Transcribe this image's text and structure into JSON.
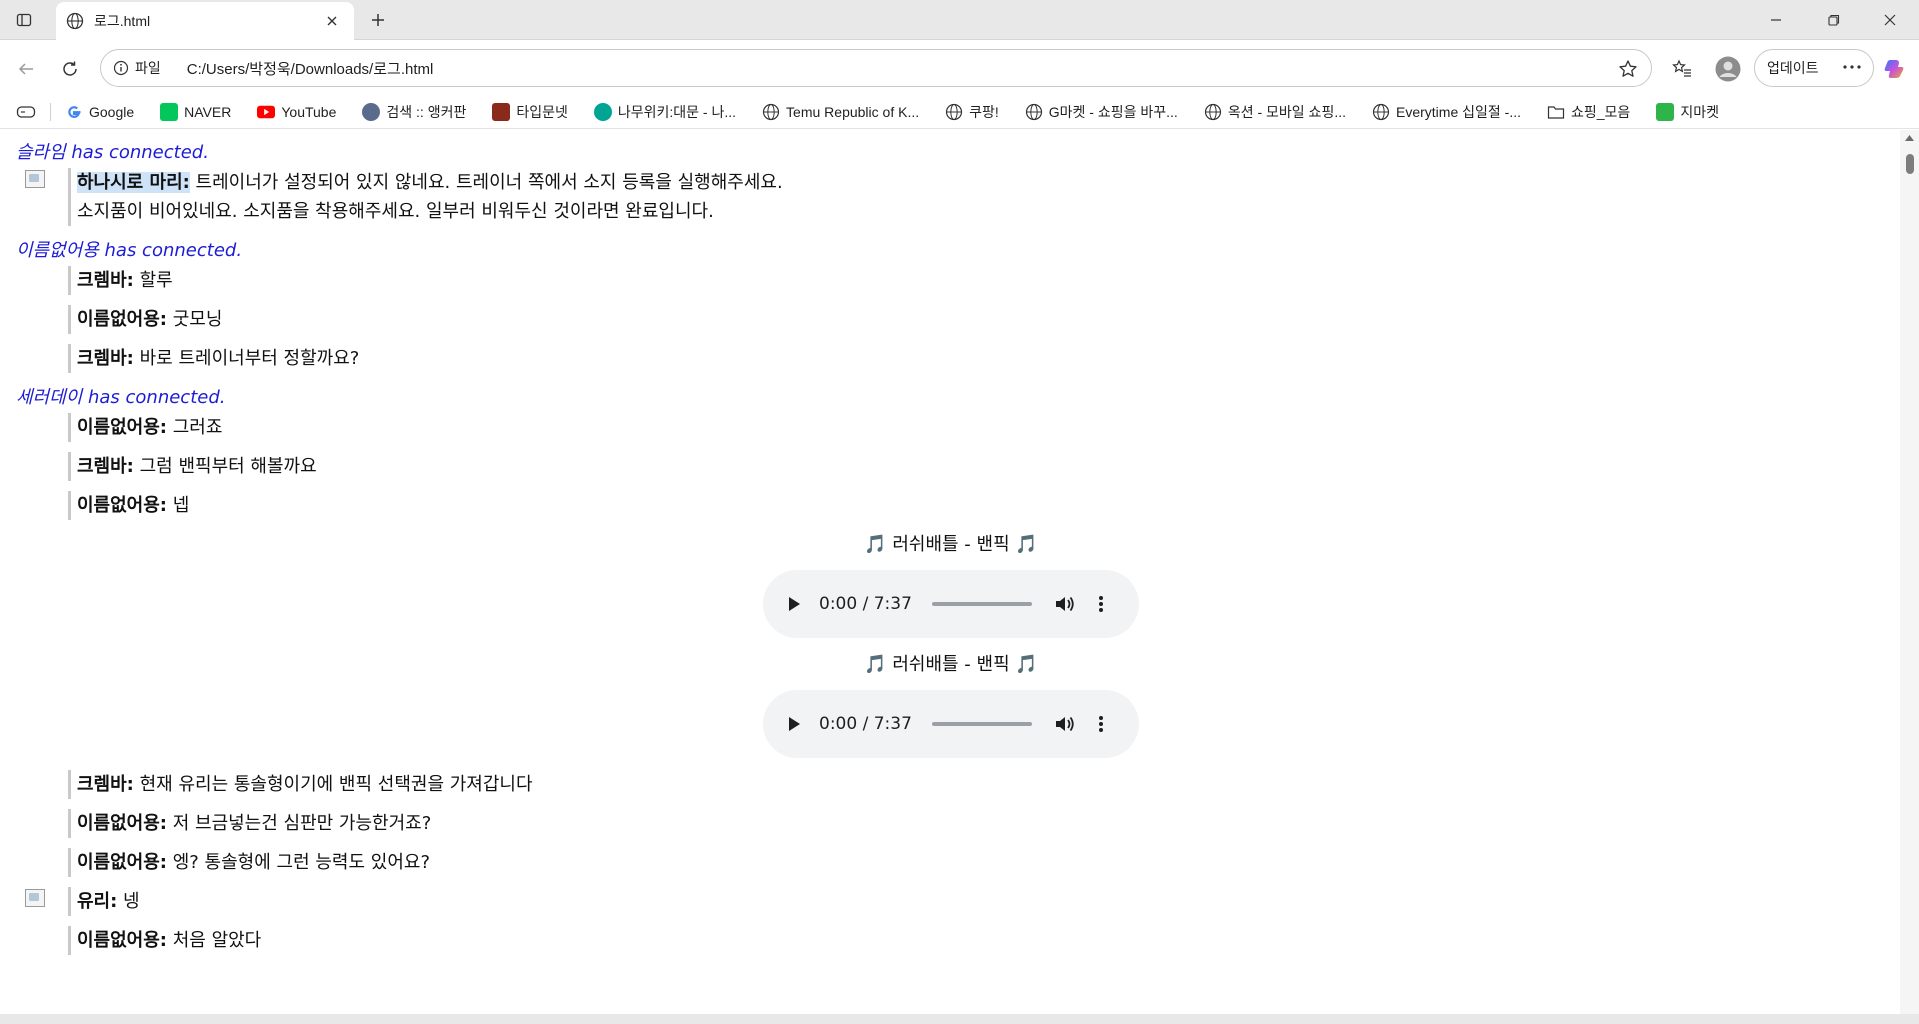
{
  "tab": {
    "title": "로그.html"
  },
  "address": {
    "scheme": "파일",
    "url": "C:/Users/박정욱/Downloads/로그.html"
  },
  "toolbar": {
    "update_label": "업데이트"
  },
  "bookmarks": [
    {
      "label": "Google",
      "icon": "google-icon",
      "color": "#4285f4"
    },
    {
      "label": "NAVER",
      "icon": "naver-icon",
      "color": "#03c75a"
    },
    {
      "label": "YouTube",
      "icon": "youtube-icon",
      "color": "#ff0000"
    },
    {
      "label": "검색 :: 앵커판",
      "icon": "anchor-site-icon",
      "color": "#5b6b8c"
    },
    {
      "label": "타입문넷",
      "icon": "typemoon-icon",
      "color": "#8a2a1a"
    },
    {
      "label": "나무위키:대문 - 나...",
      "icon": "namuwiki-icon",
      "color": "#00a495"
    },
    {
      "label": "Temu Republic of K...",
      "icon": "globe-icon",
      "color": "#555555"
    },
    {
      "label": "쿠팡!",
      "icon": "globe-icon",
      "color": "#555555"
    },
    {
      "label": "G마켓 - 쇼핑을 바꾸...",
      "icon": "globe-icon",
      "color": "#555555"
    },
    {
      "label": "옥션 - 모바일 쇼핑...",
      "icon": "globe-icon",
      "color": "#555555"
    },
    {
      "label": "Everytime 십일절 -...",
      "icon": "globe-icon",
      "color": "#555555"
    },
    {
      "label": "쇼핑_모음",
      "icon": "folder-icon",
      "color": "#555555"
    },
    {
      "label": "지마켓",
      "icon": "gmarket-icon",
      "color": "#2fb44a"
    }
  ],
  "log": {
    "sys1": "슬라임 has connected.",
    "m1": {
      "name": "하나시로 마리:",
      "line1": " 트레이너가 설정되어 있지 않네요. 트레이너 쪽에서 소지 등록을 실행해주세요.",
      "line2": "소지품이 비어있네요. 소지품을 착용해주세요. 일부러 비워두신 것이라면 완료입니다."
    },
    "sys2": "이름없어용 has connected.",
    "m2": {
      "name": "크렘바:",
      "text": " 할루"
    },
    "m3": {
      "name": "이름없어용:",
      "text": " 굿모닝"
    },
    "m4": {
      "name": "크렘바:",
      "text": " 바로 트레이너부터 정할까요?"
    },
    "sys3": "세러데이 has connected.",
    "m5": {
      "name": "이름없어용:",
      "text": " 그러죠"
    },
    "m6": {
      "name": "크렘바:",
      "text": " 그럼 밴픽부터 해볼까요"
    },
    "m7": {
      "name": "이름없어용:",
      "text": " 넵"
    },
    "bgm1": {
      "title": "🎵 러쉬배틀 - 밴픽 🎵",
      "time": "0:00 / 7:37"
    },
    "bgm2": {
      "title": "🎵 러쉬배틀 - 밴픽 🎵",
      "time": "0:00 / 7:37"
    },
    "m8": {
      "name": "크렘바:",
      "text": " 현재 유리는 통솔형이기에 밴픽 선택권을 가져갑니다"
    },
    "m9": {
      "name": "이름없어용:",
      "text": " 저 브금넣는건 심판만 가능한거죠?"
    },
    "m10": {
      "name": "이름없어용:",
      "text": " 엥? 통솔형에 그런 능력도 있어요?"
    },
    "m11": {
      "name": "유리:",
      "text": " 넹"
    },
    "m12": {
      "name": "이름없어용:",
      "text": " 처음 알았다"
    }
  }
}
